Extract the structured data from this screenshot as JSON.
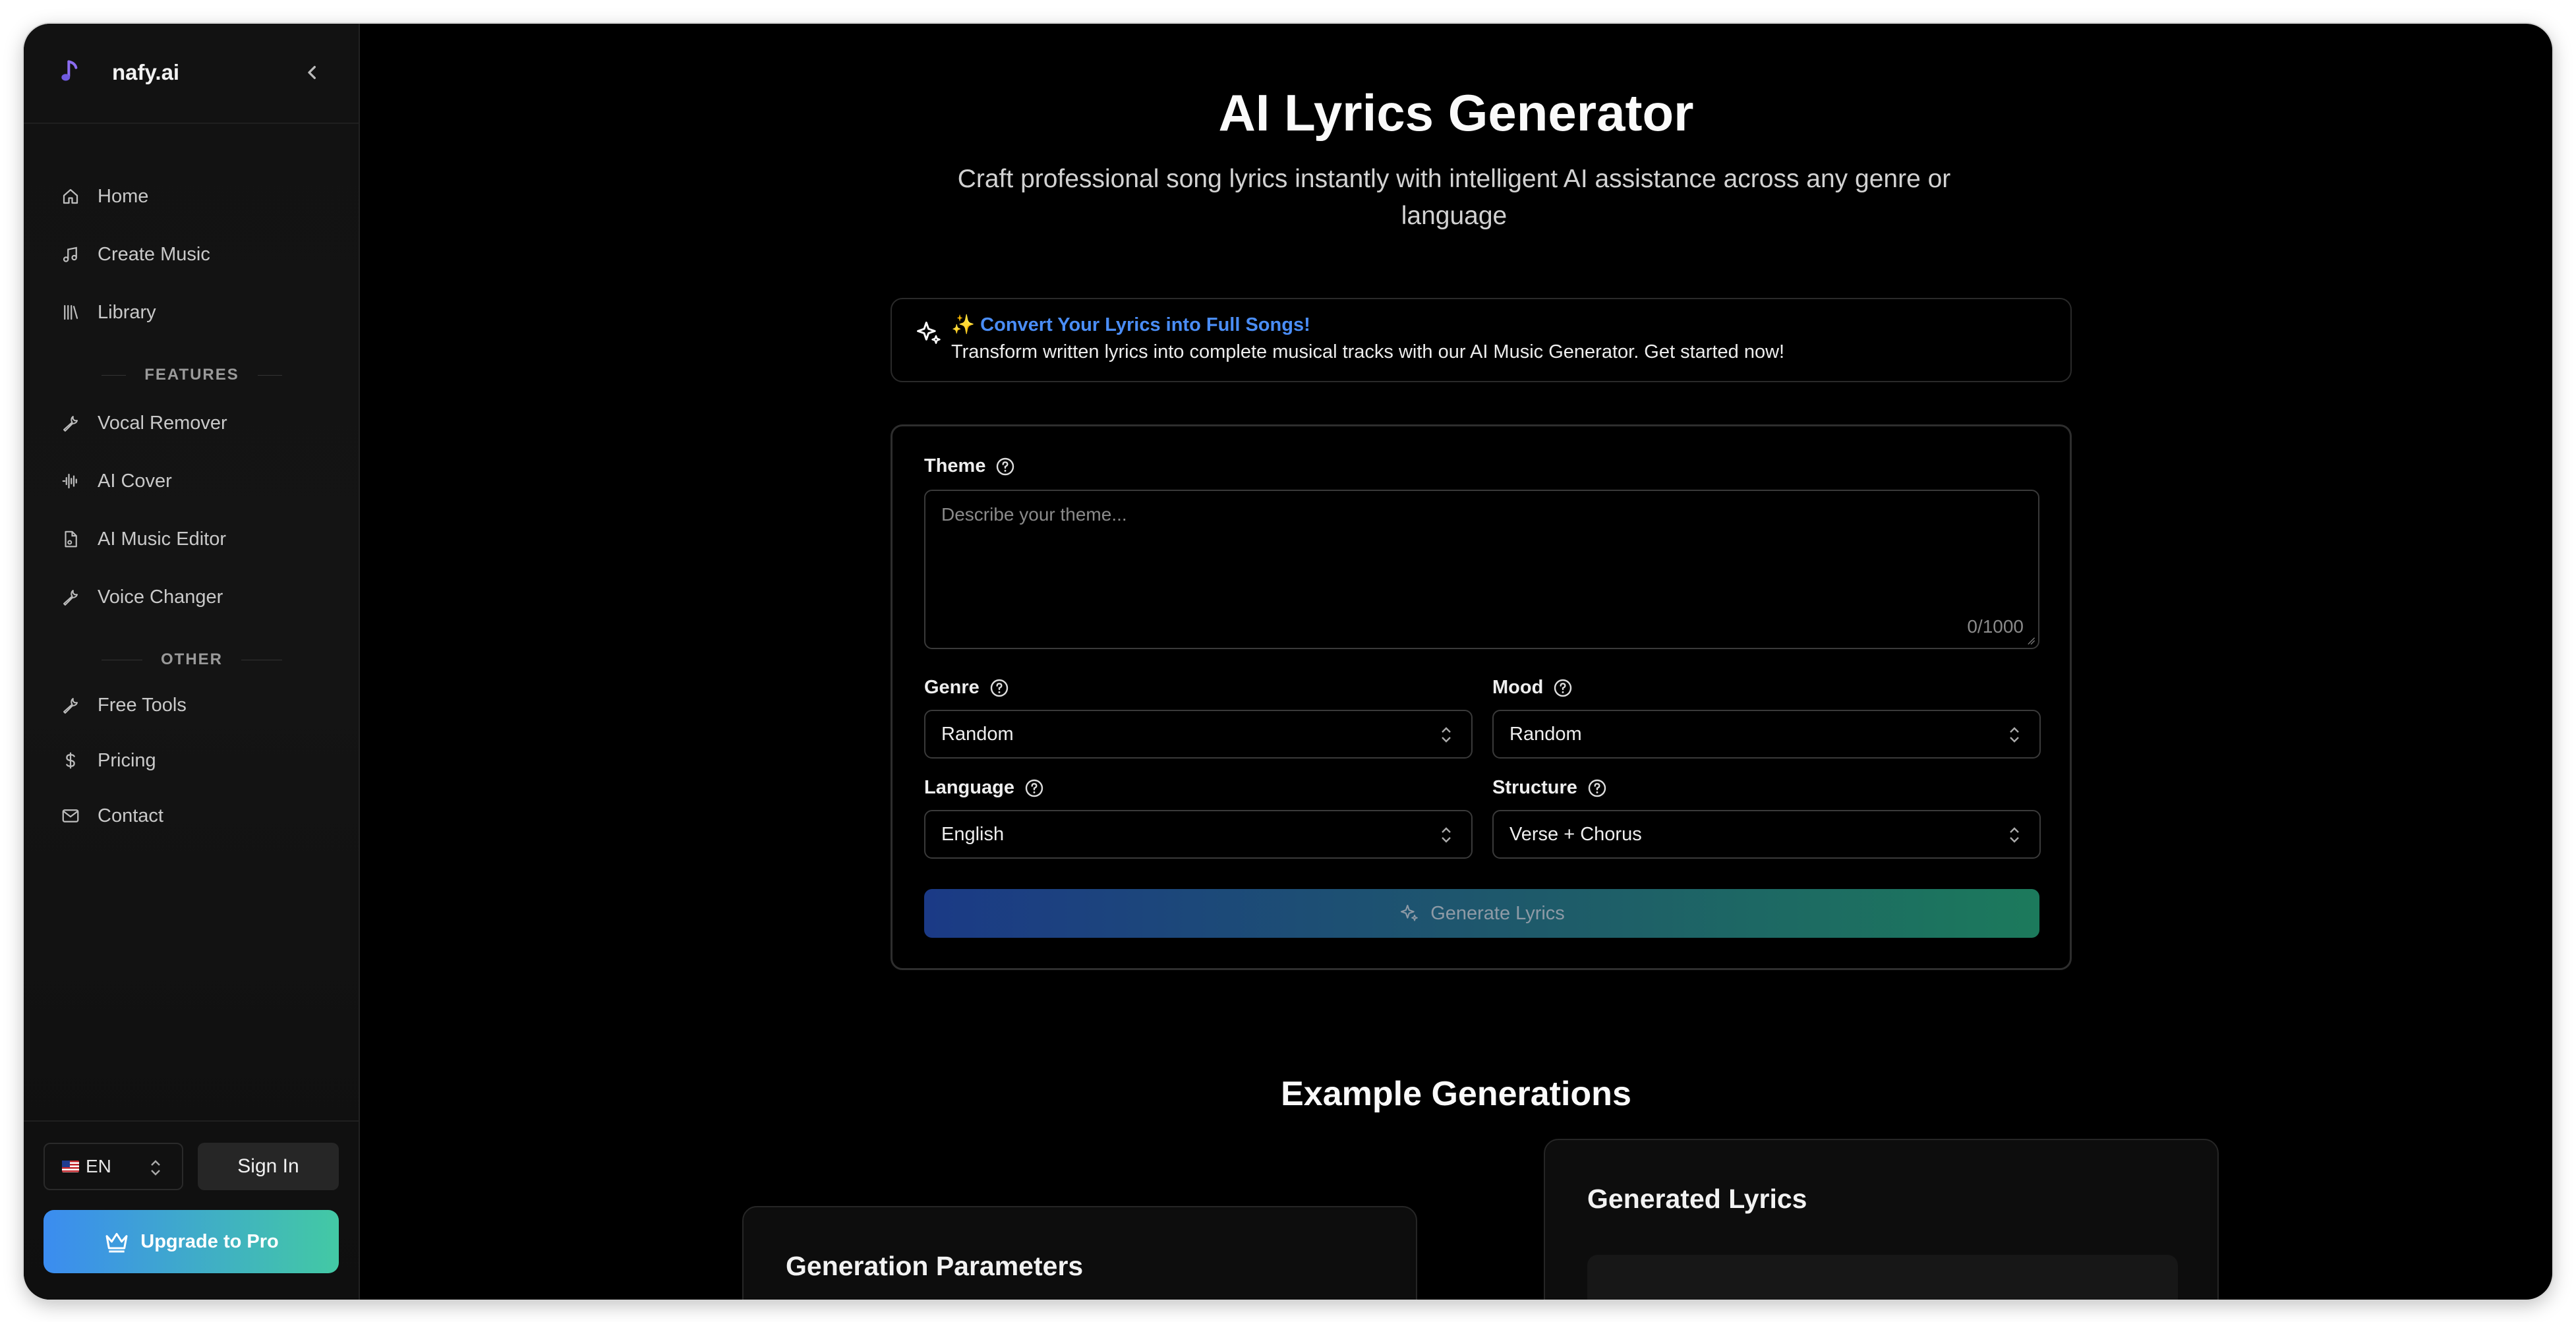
{
  "sidebar": {
    "brand": "nafy.ai",
    "nav_main": [
      {
        "label": "Home",
        "icon": "home-icon"
      },
      {
        "label": "Create Music",
        "icon": "music-note-icon"
      },
      {
        "label": "Library",
        "icon": "library-icon"
      }
    ],
    "features_heading": "FEATURES",
    "nav_features": [
      {
        "label": "Vocal Remover",
        "icon": "wrench-icon"
      },
      {
        "label": "AI Cover",
        "icon": "audio-wave-icon"
      },
      {
        "label": "AI Music Editor",
        "icon": "audio-file-icon"
      },
      {
        "label": "Voice Changer",
        "icon": "wrench-icon"
      }
    ],
    "other_heading": "OTHER",
    "nav_other": [
      {
        "label": "Free Tools",
        "icon": "wrench-icon"
      },
      {
        "label": "Pricing",
        "icon": "dollar-icon"
      },
      {
        "label": "Contact",
        "icon": "mail-icon"
      }
    ],
    "language": "EN",
    "sign_in": "Sign In",
    "upgrade": "Upgrade to Pro"
  },
  "main": {
    "title": "AI Lyrics Generator",
    "subtitle": "Craft professional song lyrics instantly with intelligent AI assistance across any genre or language",
    "promo": {
      "title": "✨ Convert Your Lyrics into Full Songs!",
      "text": "Transform written lyrics into complete musical tracks with our AI Music Generator. Get started now!"
    },
    "form": {
      "theme_label": "Theme",
      "theme_placeholder": "Describe your theme...",
      "theme_count": "0/1000",
      "genre_label": "Genre",
      "genre_value": "Random",
      "mood_label": "Mood",
      "mood_value": "Random",
      "language_label": "Language",
      "language_value": "English",
      "structure_label": "Structure",
      "structure_value": "Verse + Chorus",
      "generate": "Generate Lyrics"
    },
    "examples": {
      "heading": "Example Generations",
      "params_title": "Generation Parameters",
      "lyrics_title": "Generated Lyrics"
    }
  },
  "colors": {
    "accent_blue": "#4a8df6",
    "upgrade_gradient": [
      "#3b8cf0",
      "#43c9a4"
    ],
    "generate_gradient": [
      "#1b3a86",
      "#1c7a5c"
    ]
  }
}
